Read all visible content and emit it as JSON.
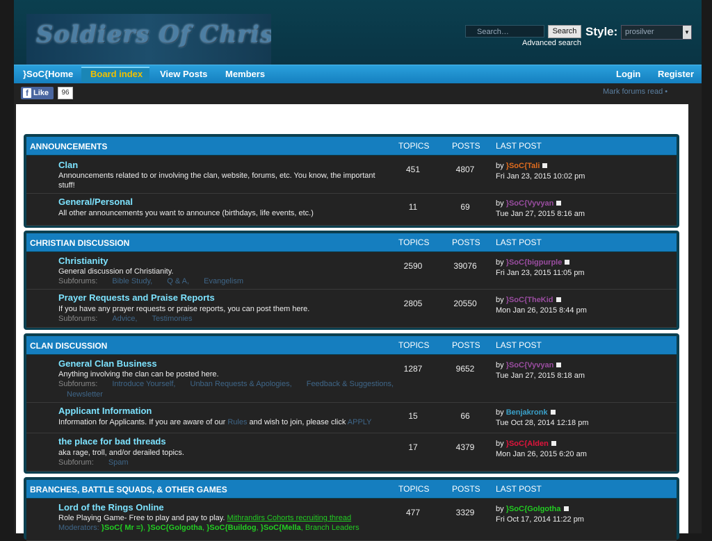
{
  "header": {
    "logo_text": "Soldiers Of Christ",
    "search_placeholder": "Search…",
    "search_button": "Search",
    "style_label": "Style:",
    "style_value": "prosilver",
    "advanced_search": "Advanced search"
  },
  "nav": {
    "items": [
      "}SoC{Home",
      "Board index",
      "View Posts",
      "Members"
    ],
    "login": "Login",
    "register": "Register"
  },
  "subbar": {
    "like": "Like",
    "like_count": "96",
    "mark_read": "Mark forums read •"
  },
  "columns": {
    "topics": "TOPICS",
    "posts": "POSTS",
    "last_post": "LAST POST"
  },
  "categories": [
    {
      "title": "ANNOUNCEMENTS",
      "forums": [
        {
          "name": "Clan",
          "desc": "Announcements related to or involving the clan, website, forums, etc. You know, the important stuff!",
          "topics": "451",
          "posts": "4807",
          "by": "by",
          "user": "}SoC{Tali",
          "user_color": "#e06c1e",
          "date": "Fri Jan 23, 2015 10:02 pm"
        },
        {
          "name": "General/Personal",
          "desc": "All other announcements you want to announce (birthdays, life events, etc.)",
          "topics": "11",
          "posts": "69",
          "by": "by",
          "user": "}SoC{Vyvyan",
          "user_color": "#9a4da0",
          "date": "Tue Jan 27, 2015 8:16 am"
        }
      ]
    },
    {
      "title": "CHRISTIAN DISCUSSION",
      "forums": [
        {
          "name": "Christianity",
          "desc": "General discussion of Christianity.",
          "sub_label": "Subforums:",
          "subs": [
            "Bible Study,",
            "Q & A,",
            "Evangelism"
          ],
          "topics": "2590",
          "posts": "39076",
          "by": "by",
          "user": "}SoC{bigpurple",
          "user_color": "#9a4da0",
          "date": "Fri Jan 23, 2015 11:05 pm"
        },
        {
          "name": "Prayer Requests and Praise Reports",
          "desc": "If you have any prayer requests or praise reports, you can post them here.",
          "sub_label": "Subforums:",
          "subs": [
            "Advice,",
            "Testimonies"
          ],
          "topics": "2805",
          "posts": "20550",
          "by": "by",
          "user": "}SoC{TheKid",
          "user_color": "#9a4da0",
          "date": "Mon Jan 26, 2015 8:44 pm"
        }
      ]
    },
    {
      "title": "CLAN DISCUSSION",
      "forums": [
        {
          "name": "General Clan Business",
          "desc": "Anything involving the clan can be posted here.",
          "sub_label": "Subforums:",
          "subs": [
            "Introduce Yourself,",
            "Unban Requests & Apologies,",
            "Feedback & Suggestions,"
          ],
          "subs2": "Newsletter",
          "topics": "1287",
          "posts": "9652",
          "by": "by",
          "user": "}SoC{Vyvyan",
          "user_color": "#9a4da0",
          "date": "Tue Jan 27, 2015 8:18 am"
        },
        {
          "name": "Applicant Information",
          "desc_a": "Information for Applicants. If you are aware of our",
          "desc_link1": "Rules",
          "desc_b": "and wish to join, please click",
          "desc_link2": "APPLY",
          "topics": "15",
          "posts": "66",
          "by": "by",
          "user": "Benjakronk",
          "user_color": "#3aa0c8",
          "date": "Tue Oct 28, 2014 12:18 pm"
        },
        {
          "name": "the place for bad threads",
          "desc": "aka rage, troll, and/or derailed topics.",
          "sub_label": "Subforum:",
          "subs": [
            "Spam"
          ],
          "topics": "17",
          "posts": "4379",
          "by": "by",
          "user": "}SoC{Alden",
          "user_color": "#e0143c",
          "date": "Mon Jan 26, 2015 6:20 am"
        }
      ]
    },
    {
      "title": "BRANCHES, BATTLE SQUADS, & OTHER GAMES",
      "forums": [
        {
          "name": "Lord of the Rings Online",
          "desc_a": "Role Playing Game- Free to play and pay to play.",
          "desc_link1": "Mithrandirs Cohorts recruiting thread",
          "mod_label": "Moderators:",
          "mods": [
            "}SoC{ Mr =)",
            "}SoC{Golgotha",
            "}SoC{Buildog",
            "}SoC{Mella"
          ],
          "mods_link": "Branch Leaders",
          "topics": "477",
          "posts": "3329",
          "by": "by",
          "user": "}SoC{Golgotha",
          "user_color": "#22cc22",
          "date": "Fri Oct 17, 2014 11:22 pm"
        }
      ]
    }
  ]
}
